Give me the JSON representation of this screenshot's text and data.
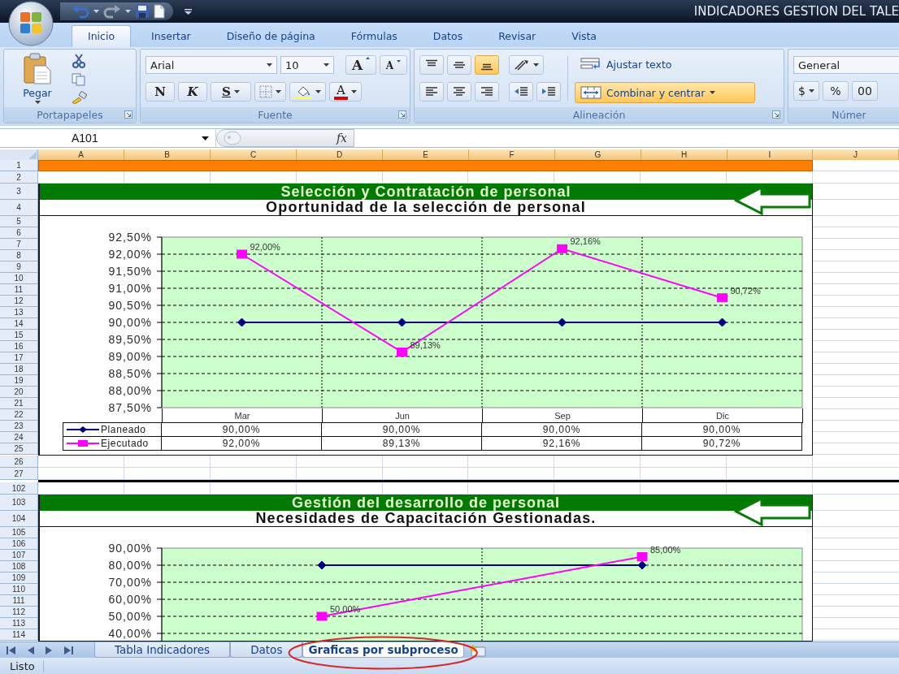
{
  "window": {
    "title": "INDICADORES GESTION DEL TALE"
  },
  "ribbon": {
    "tabs": [
      {
        "label": "Inicio",
        "selected": true
      },
      {
        "label": "Insertar",
        "selected": false
      },
      {
        "label": "Diseño de página",
        "selected": false
      },
      {
        "label": "Fórmulas",
        "selected": false
      },
      {
        "label": "Datos",
        "selected": false
      },
      {
        "label": "Revisar",
        "selected": false
      },
      {
        "label": "Vista",
        "selected": false
      }
    ],
    "groups": [
      {
        "kind": "clipboard",
        "label": "Portapapeles",
        "paste_label": "Pegar"
      },
      {
        "kind": "font",
        "label": "Fuente",
        "font_name": "Arial",
        "font_size": "10",
        "grow_label": "A",
        "shrink_label": "A",
        "style_buttons": [
          "N",
          "K",
          "S"
        ],
        "font_color_label": "A"
      },
      {
        "kind": "alignment",
        "label": "Alineación",
        "align_buttons": [
          {
            "on": false
          },
          {
            "on": false
          },
          {
            "on": true
          },
          {
            "on": false
          },
          {
            "on": false
          },
          {
            "on": false
          }
        ],
        "wrap_text": {
          "label": "Ajustar texto",
          "on": false
        },
        "merge": {
          "label": "Combinar y centrar",
          "on": true
        }
      },
      {
        "kind": "number",
        "label": "Númer",
        "format": "General",
        "buttons": [
          "$",
          "%",
          "00"
        ]
      }
    ]
  },
  "formula_bar": {
    "name_box": "A101",
    "function_label": "fx"
  },
  "sheet": {
    "columns": [
      "A",
      "B",
      "C",
      "D",
      "E",
      "F",
      "G",
      "H",
      "I",
      "J"
    ],
    "blocks": [
      {
        "kind": "band",
        "rows": [
          "1"
        ]
      },
      {
        "kind": "blank",
        "rows": [
          "2"
        ]
      },
      {
        "kind": "section",
        "rows": [
          "3",
          "4",
          "5",
          "6",
          "7",
          "8",
          "9",
          "10",
          "11",
          "12",
          "13",
          "14",
          "15",
          "16",
          "17",
          "18",
          "19",
          "20",
          "21",
          "22",
          "23",
          "24",
          "25"
        ],
        "title": "Selección y Contratación de personal",
        "subtitle": "Oportunidad de la selección de personal",
        "chart_data": {
          "type": "line",
          "categories": [
            "Mar",
            "Jun",
            "Sep",
            "Dic"
          ],
          "series": [
            {
              "name": "Planeado",
              "color": "#000080",
              "marker": "diamond",
              "values": [
                90,
                90,
                90,
                90
              ]
            },
            {
              "name": "Ejecutado",
              "color": "#ff00ff",
              "marker": "square",
              "values": [
                92,
                89.13,
                92.16,
                90.72
              ]
            }
          ],
          "ylim": [
            87.5,
            92.5
          ],
          "yticks": [
            {
              "value": 92.5,
              "label": "92,50%"
            },
            {
              "value": 92,
              "label": "92,00%"
            },
            {
              "value": 91.5,
              "label": "91,50%"
            },
            {
              "value": 91,
              "label": "91,00%"
            },
            {
              "value": 90.5,
              "label": "90,50%"
            },
            {
              "value": 90,
              "label": "90,00%"
            },
            {
              "value": 89.5,
              "label": "89,50%"
            },
            {
              "value": 89,
              "label": "89,00%"
            },
            {
              "value": 88.5,
              "label": "88,50%"
            },
            {
              "value": 88,
              "label": "88,00%"
            },
            {
              "value": 87.5,
              "label": "87,50%"
            }
          ],
          "value_labels": [
            null,
            [
              "92,00%",
              "89,13%",
              "92,16%",
              "90,72%"
            ]
          ],
          "grid": {
            "horizontal": true,
            "vertical": true
          },
          "legend": true
        },
        "data_table": {
          "rows": [
            {
              "cells": [
                "90,00%",
                "90,00%",
                "90,00%",
                "90,00%"
              ]
            },
            {
              "cells": [
                "92,00%",
                "89,13%",
                "92,16%",
                "90,72%"
              ]
            }
          ]
        }
      },
      {
        "kind": "blank",
        "rows": [
          "26",
          "27"
        ]
      },
      {
        "kind": "split"
      },
      {
        "kind": "blank",
        "rows": [
          "102"
        ]
      },
      {
        "kind": "section",
        "rows": [
          "103",
          "104",
          "105",
          "106",
          "107",
          "108",
          "109",
          "110",
          "111",
          "112",
          "113",
          "114"
        ],
        "title": "Gestión del desarrollo de personal",
        "subtitle": "Necesidades de Capacitación Gestionadas.",
        "chart_data": {
          "type": "line",
          "series": [
            {
              "color": "#000080",
              "marker": "diamond",
              "values": [
                80,
                80
              ]
            },
            {
              "color": "#ff00ff",
              "marker": "square",
              "values": [
                50,
                85
              ]
            }
          ],
          "ylim": [
            40,
            90
          ],
          "yticks": [
            {
              "value": 90,
              "label": "90,00%"
            },
            {
              "value": 80,
              "label": "80,00%"
            },
            {
              "value": 70,
              "label": "70,00%"
            },
            {
              "value": 60,
              "label": "60,00%"
            },
            {
              "value": 50,
              "label": "50,00%"
            },
            {
              "value": 40,
              "label": "40,00%"
            }
          ],
          "value_labels": [
            null,
            [
              "50,00%",
              "85,00%"
            ]
          ],
          "grid": {
            "horizontal": true,
            "vertical": true
          }
        }
      }
    ]
  },
  "sheet_tabs": [
    {
      "label": "Tabla Indicadores",
      "selected": false,
      "circled": false
    },
    {
      "label": "Datos",
      "selected": false,
      "circled": false
    },
    {
      "label": "Graficas por subproceso",
      "selected": true,
      "circled": true
    }
  ],
  "status_bar": {
    "text": "Listo"
  }
}
